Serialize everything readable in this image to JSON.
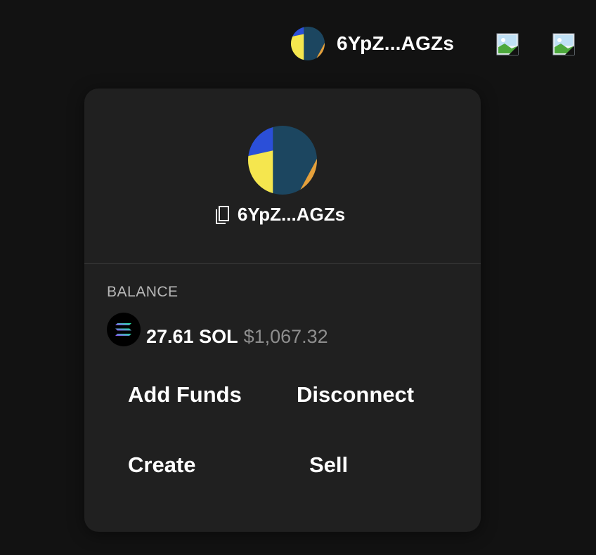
{
  "header": {
    "wallet_address": "6YpZ...AGZs",
    "avatar_icon": "wallet-avatar-icon",
    "image_placeholders": [
      "broken-image-icon",
      "broken-image-icon"
    ]
  },
  "wallet_panel": {
    "address": "6YpZ...AGZs",
    "copy_icon": "copy-icon",
    "balance_label": "BALANCE",
    "token_icon": "solana-icon",
    "balance_sol": "27.61 SOL",
    "balance_usd": "$1,067.32",
    "actions": {
      "add_funds": "Add Funds",
      "disconnect": "Disconnect",
      "create": "Create",
      "sell": "Sell"
    }
  },
  "colors": {
    "background": "#121212",
    "panel": "#202020",
    "avatar_navy": "#1c4660",
    "avatar_yellow": "#f5e64e",
    "avatar_blue": "#2b4fd8",
    "avatar_orange": "#e5a03b",
    "muted_text": "#8e8e8e"
  }
}
